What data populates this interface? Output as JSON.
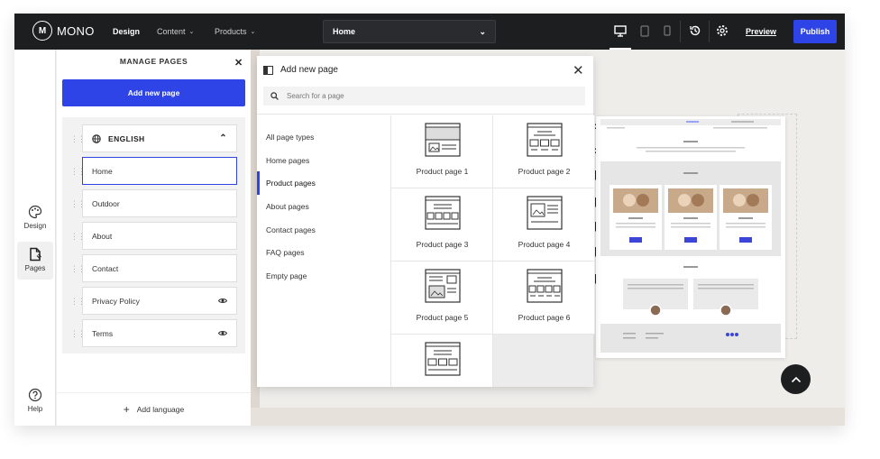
{
  "brand": {
    "logo_mark": "M",
    "name": "MONO"
  },
  "nav": {
    "design": "Design",
    "content": "Content",
    "products": "Products"
  },
  "page_select": {
    "value": "Home"
  },
  "topbar": {
    "preview": "Preview",
    "publish": "Publish"
  },
  "rail": {
    "design": "Design",
    "pages": "Pages",
    "help": "Help"
  },
  "manage": {
    "title": "MANAGE PAGES",
    "add_button": "Add new page",
    "language": "ENGLISH",
    "pages": [
      "Home",
      "Outdoor",
      "About",
      "Contact",
      "Privacy Policy",
      "Terms"
    ],
    "add_language": "Add language"
  },
  "modal": {
    "title": "Add new page",
    "search_placeholder": "Search for a page",
    "types": [
      "All page types",
      "Home pages",
      "Product pages",
      "About pages",
      "Contact pages",
      "FAQ pages",
      "Empty page"
    ],
    "active_type": "Product pages",
    "templates": [
      "Product page 1",
      "Product page 2",
      "Product page 3",
      "Product page 4",
      "Product page 5",
      "Product page 6"
    ]
  },
  "colors": {
    "accent": "#2e44e6",
    "topbar": "#1d1e20",
    "canvas": "#efedea"
  }
}
